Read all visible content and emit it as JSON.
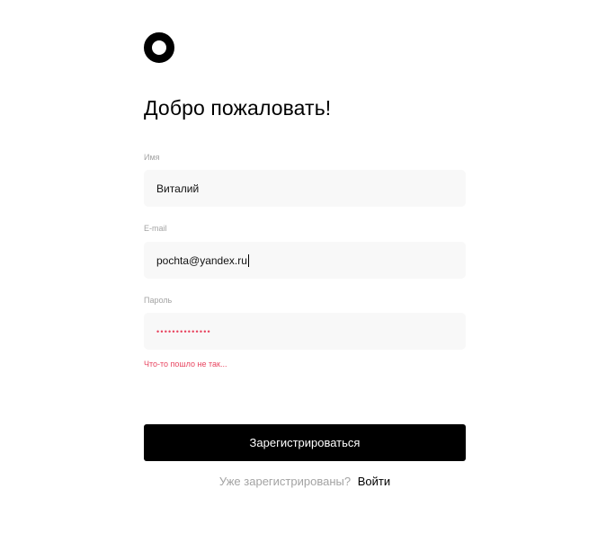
{
  "app": {
    "logo_icon": "ring-logo-icon",
    "title": "Добро пожаловать!"
  },
  "form": {
    "name": {
      "label": "Имя",
      "value": "Виталий"
    },
    "email": {
      "label": "E-mail",
      "value": "pochta@yandex.ru"
    },
    "password": {
      "label": "Пароль",
      "value_masked": "••••••••••••••",
      "error": "Что-то пошло не так..."
    },
    "submit_label": "Зарегистрироваться"
  },
  "footer": {
    "question": "Уже зарегистрированы?",
    "login_label": "Войти"
  },
  "colors": {
    "accent": "#000000",
    "error": "#e8445f",
    "field_background": "#f8f8f8",
    "muted_text": "#a3a3a3"
  }
}
